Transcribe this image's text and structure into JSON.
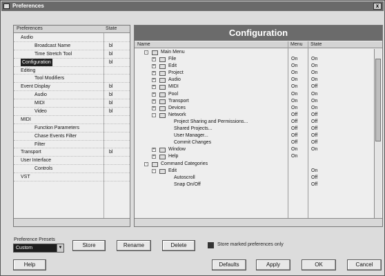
{
  "window": {
    "title": "Preferences",
    "close_label": "x"
  },
  "left": {
    "columns": {
      "name": "Preferences",
      "state": "State"
    },
    "rows": [
      {
        "label": "Audio",
        "state": "",
        "indent": 1
      },
      {
        "label": "Broadcast Name",
        "state": "bl",
        "indent": 3
      },
      {
        "label": "Time Stretch Tool",
        "state": "bl",
        "indent": 3
      },
      {
        "label": "Configuration",
        "state": "bl",
        "indent": 1,
        "selected": true
      },
      {
        "label": "Editing",
        "state": "",
        "indent": 1
      },
      {
        "label": "Tool Modifiers",
        "state": "",
        "indent": 3
      },
      {
        "label": "Event Display",
        "state": "bl",
        "indent": 1
      },
      {
        "label": "Audio",
        "state": "bl",
        "indent": 3
      },
      {
        "label": "MIDI",
        "state": "bl",
        "indent": 3
      },
      {
        "label": "Video",
        "state": "bl",
        "indent": 3
      },
      {
        "label": "MIDI",
        "state": "",
        "indent": 1
      },
      {
        "label": "Function Parameters",
        "state": "",
        "indent": 3
      },
      {
        "label": "Chase Events Filter",
        "state": "",
        "indent": 3
      },
      {
        "label": "Filter",
        "state": "",
        "indent": 3
      },
      {
        "label": "Transport",
        "state": "bl",
        "indent": 1
      },
      {
        "label": "User Interface",
        "state": "",
        "indent": 1
      },
      {
        "label": "Controls",
        "state": "",
        "indent": 3
      },
      {
        "label": "VST",
        "state": "",
        "indent": 1
      }
    ]
  },
  "right": {
    "header": "Configuration",
    "columns": {
      "name": "Name",
      "menu": "Menu",
      "state": "State"
    },
    "rows": [
      {
        "label": "Main Menu",
        "exp": "-",
        "level": 0,
        "c1": "",
        "c2": ""
      },
      {
        "label": "File",
        "exp": "+",
        "level": 1,
        "c1": "On",
        "c2": "On"
      },
      {
        "label": "Edit",
        "exp": "+",
        "level": 1,
        "c1": "On",
        "c2": "On"
      },
      {
        "label": "Project",
        "exp": "+",
        "level": 1,
        "c1": "On",
        "c2": "On"
      },
      {
        "label": "Audio",
        "exp": "+",
        "level": 1,
        "c1": "On",
        "c2": "On"
      },
      {
        "label": "MIDI",
        "exp": "+",
        "level": 1,
        "c1": "On",
        "c2": "Off"
      },
      {
        "label": "Pool",
        "exp": "+",
        "level": 1,
        "c1": "On",
        "c2": "On"
      },
      {
        "label": "Transport",
        "exp": "+",
        "level": 1,
        "c1": "On",
        "c2": "On"
      },
      {
        "label": "Devices",
        "exp": "+",
        "level": 1,
        "c1": "On",
        "c2": "On"
      },
      {
        "label": "Network",
        "exp": "-",
        "level": 1,
        "c1": "Off",
        "c2": "Off"
      },
      {
        "label": "Project Sharing and Permissions...",
        "exp": "",
        "level": 3,
        "c1": "Off",
        "c2": "Off"
      },
      {
        "label": "Shared Projects...",
        "exp": "",
        "level": 3,
        "c1": "Off",
        "c2": "Off"
      },
      {
        "label": "User Manager...",
        "exp": "",
        "level": 3,
        "c1": "Off",
        "c2": "Off"
      },
      {
        "label": "Commit Changes",
        "exp": "",
        "level": 3,
        "c1": "Off",
        "c2": "Off"
      },
      {
        "label": "Window",
        "exp": "+",
        "level": 1,
        "c1": "On",
        "c2": "On"
      },
      {
        "label": "Help",
        "exp": "+",
        "level": 1,
        "c1": "On",
        "c2": ""
      },
      {
        "label": "Command Categories",
        "exp": "-",
        "level": 0,
        "c1": "",
        "c2": ""
      },
      {
        "label": "Edit",
        "exp": "-",
        "level": 1,
        "c1": "",
        "c2": "On"
      },
      {
        "label": "Autoscroll",
        "exp": "",
        "level": 3,
        "c1": "",
        "c2": "Off"
      },
      {
        "label": "Snap On/Off",
        "exp": "",
        "level": 3,
        "c1": "",
        "c2": "Off"
      }
    ]
  },
  "bottom": {
    "preset_label": "Preference Presets",
    "preset_value": "Custom",
    "store": "Store",
    "rename": "Rename",
    "delete": "Delete",
    "checkbox_label": "Store marked preferences only",
    "help": "Help",
    "defaults": "Defaults",
    "apply": "Apply",
    "ok": "OK",
    "cancel": "Cancel"
  }
}
